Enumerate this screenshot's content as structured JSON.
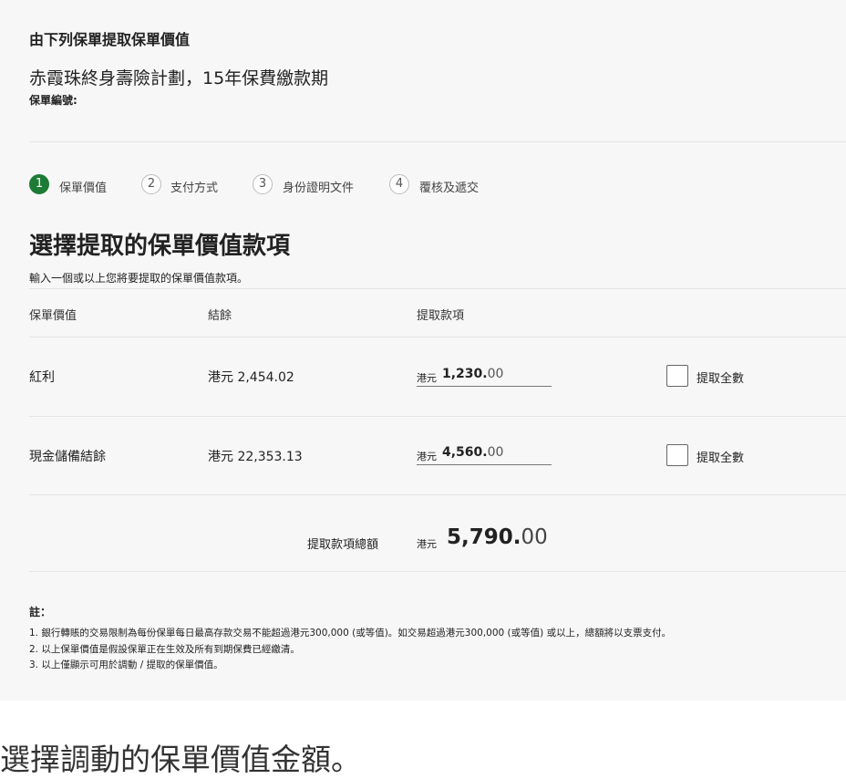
{
  "header": {
    "title": "由下列保單提取保單價值",
    "plan_name": "赤霞珠終身壽險計劃，15年保費繳款期",
    "policy_no_label": "保單編號:"
  },
  "steps": [
    {
      "number": "1",
      "label": "保單價值",
      "active": true
    },
    {
      "number": "2",
      "label": "支付方式",
      "active": false
    },
    {
      "number": "3",
      "label": "身份證明文件",
      "active": false
    },
    {
      "number": "4",
      "label": "覆核及遞交",
      "active": false
    }
  ],
  "section": {
    "title": "選擇提取的保單價值款項",
    "description": "輸入一個或以上您將要提取的保單價值款項。"
  },
  "table": {
    "columns": [
      "保單價值",
      "結餘",
      "提取款項"
    ],
    "rows": [
      {
        "name": "紅利",
        "balance": "港元 2,454.02",
        "currency": "港元",
        "amount_int": "1,230.",
        "amount_dec": "00",
        "checkbox_label": "提取全數",
        "checked": false
      },
      {
        "name": "現金儲備結餘",
        "balance": "港元 22,353.13",
        "currency": "港元",
        "amount_int": "4,560.",
        "amount_dec": "00",
        "checkbox_label": "提取全數",
        "checked": false
      }
    ]
  },
  "total": {
    "label": "提取款項總額",
    "currency": "港元",
    "amount_int": "5,790.",
    "amount_dec": "00"
  },
  "notes": {
    "heading": "註：",
    "items": [
      "1. 銀行轉賬的交易限制為每份保單每日最高存款交易不能超過港元300,000 (或等值)。如交易超過港元300,000 (或等值) 或以上，總額將以支票支付。",
      "2. 以上保單價值是假設保單正在生效及所有到期保費已經繳清。",
      "3. 以上僅顯示可用於調動 / 提取的保單價值。"
    ]
  },
  "caption": "選擇調動的保單價值金額。",
  "colors": {
    "accent": "#1e7b35",
    "panel_bg": "#f7f7f7"
  }
}
